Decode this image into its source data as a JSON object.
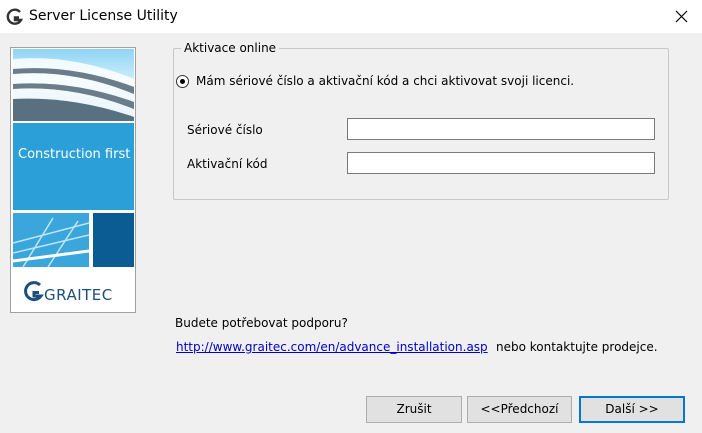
{
  "window": {
    "title": "Server License Utility"
  },
  "sidebar": {
    "banner_text": "Construction first",
    "logo_text": "GRAITEC"
  },
  "group": {
    "legend": "Aktivace online",
    "radio_label": "Mám sériové číslo a aktivační kód a chci aktivovat svoji licenci.",
    "radio_checked": true,
    "serial_label": "Sériové číslo",
    "serial_value": "",
    "activation_label": "Aktivační kód",
    "activation_value": ""
  },
  "support": {
    "question": "Budete potřebovat podporu?",
    "link_text": "http://www.graitec.com/en/advance_installation.asp",
    "contact_text": "nebo kontaktujte prodejce."
  },
  "buttons": {
    "cancel": "Zrušit",
    "previous": "<<Předchozí",
    "next": "Další >>"
  },
  "colors": {
    "link": "#0000cc",
    "default_button_border": "#0078d7",
    "banner": "#2a9fd8",
    "brand_dark": "#0b5c92"
  }
}
